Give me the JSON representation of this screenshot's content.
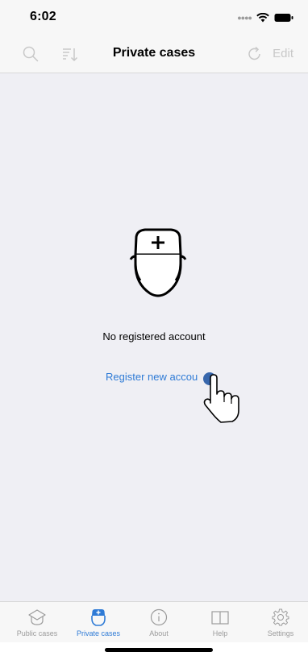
{
  "status_bar": {
    "time": "6:02"
  },
  "nav_bar": {
    "title": "Private cases",
    "edit_label": "Edit"
  },
  "empty_state": {
    "message": "No registered account",
    "register_link": "Register new accou"
  },
  "tabs": [
    {
      "label": "Public cases",
      "icon": "mortarboard-icon",
      "active": false
    },
    {
      "label": "Private cases",
      "icon": "nurse-icon",
      "active": true
    },
    {
      "label": "About",
      "icon": "info-icon",
      "active": false
    },
    {
      "label": "Help",
      "icon": "book-icon",
      "active": false
    },
    {
      "label": "Settings",
      "icon": "gear-icon",
      "active": false
    }
  ],
  "colors": {
    "accent": "#2f7bd6",
    "inactive": "#9b9b9b",
    "background": "#efeff4"
  }
}
